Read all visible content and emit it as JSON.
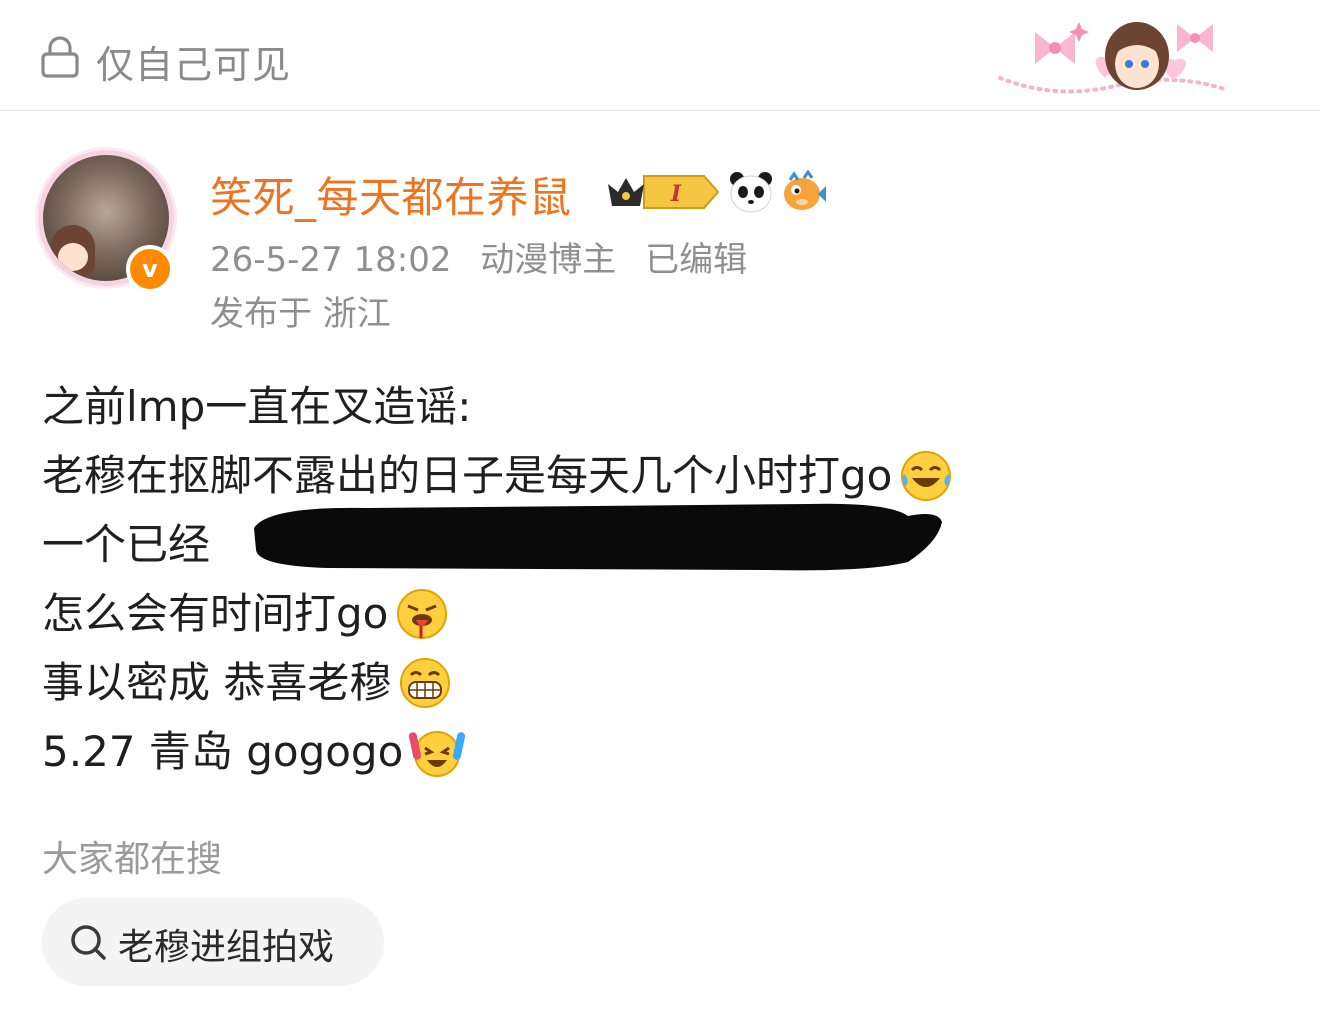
{
  "header": {
    "visibility_label": "仅自己可见",
    "lock_icon": "lock-icon"
  },
  "author": {
    "name": "笑死_每天都在养鼠",
    "verified_label": "v",
    "name_color": "#f0731f",
    "badges": [
      "crown-level-badge",
      "panda-icon",
      "pufferfish-icon"
    ],
    "crown_badge_text": "I",
    "timestamp": "26-5-27 18:02",
    "role": "动漫博主",
    "edited": "已编辑",
    "location": "发布于 浙江"
  },
  "post": {
    "lines": [
      {
        "text": "之前lmp一直在叉造谣:",
        "emoji": ""
      },
      {
        "text": "老穆在抠脚不露出的日子是每天几个小时打go",
        "emoji": "tears-of-joy"
      },
      {
        "text": "一个已经",
        "emoji": ""
      },
      {
        "text": "怎么会有时间打go",
        "emoji": "tongue-bleeding"
      },
      {
        "text": "事以密成 恭喜老穆",
        "emoji": "grin"
      },
      {
        "text": "5.27 青岛 gogogo",
        "emoji": "cheer"
      }
    ]
  },
  "trending": {
    "title": "大家都在搜",
    "items": [
      {
        "label": "老穆进组拍戏",
        "icon": "search-icon"
      }
    ]
  }
}
